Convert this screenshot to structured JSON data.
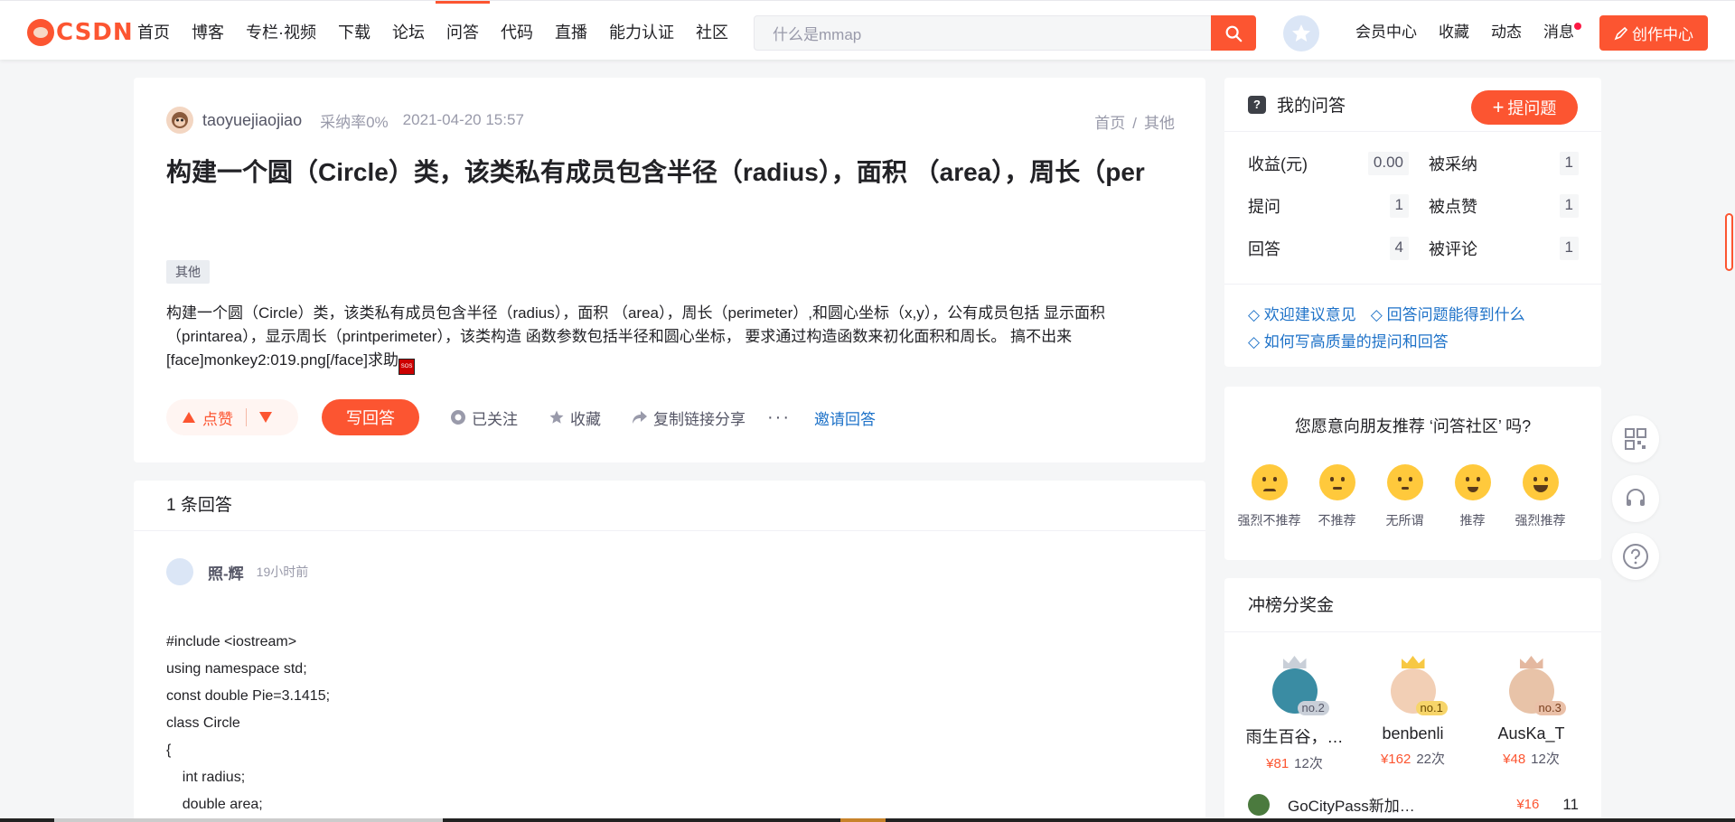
{
  "nav": {
    "logo": "CSDN",
    "items": [
      "首页",
      "博客",
      "专栏·视频",
      "下载",
      "论坛",
      "问答",
      "代码",
      "直播",
      "能力认证",
      "社区"
    ],
    "active_index": 5,
    "search_placeholder": "什么是mmap",
    "right_items": [
      "会员中心",
      "收藏",
      "动态",
      "消息"
    ],
    "create_label": "创作中心",
    "accent": "#fc5531"
  },
  "question": {
    "author": "taoyuejiaojiao",
    "accept_rate": "采纳率0%",
    "time": "2021-04-20 15:57",
    "breadcrumb": [
      "首页",
      "其他"
    ],
    "title": "构建一个圆（Circle）类，该类私有成员包含半径（radius），面积 （area），周长（per",
    "tag": "其他",
    "body": "构建一个圆（Circle）类，该类私有成员包含半径（radius），面积 （area），周长（perimeter）,和圆心坐标（x,y），公有成员包括 显示面积（printarea），显示周长（printperimeter），该类构造 函数参数包括半径和圆心坐标， 要求通过构造函数来初化面积和周长。 搞不出来[face]monkey2:019.png[/face]求助",
    "actions": {
      "like": "点赞",
      "write": "写回答",
      "follow": "已关注",
      "favorite": "收藏",
      "share": "复制链接分享",
      "more": "···",
      "invite": "邀请回答"
    }
  },
  "answers": {
    "count_label": "1 条回答",
    "items": [
      {
        "user": "照-辉",
        "time": "19小时前",
        "code": [
          "#include <iostream>",
          "using namespace std;",
          "const double Pie=3.1415;",
          "class Circle",
          "{",
          "    int radius;",
          "    double area;"
        ]
      }
    ]
  },
  "my_questions": {
    "title": "我的问答",
    "ask_label": "提问题",
    "stats": [
      [
        {
          "label": "收益(元)",
          "value": "0.00"
        },
        {
          "label": "被采纳",
          "value": "1"
        }
      ],
      [
        {
          "label": "提问",
          "value": "1"
        },
        {
          "label": "被点赞",
          "value": "1"
        }
      ],
      [
        {
          "label": "回答",
          "value": "4"
        },
        {
          "label": "被评论",
          "value": "1"
        }
      ]
    ],
    "links": [
      "◇ 欢迎建议意见",
      "◇ 回答问题能得到什么",
      "◇ 如何写高质量的提问和回答"
    ]
  },
  "recommend": {
    "title": "您愿意向朋友推荐 ‘问答社区’ 吗?",
    "options": [
      "强烈不推荐",
      "不推荐",
      "无所谓",
      "推荐",
      "强烈推荐"
    ]
  },
  "ranking": {
    "title": "冲榜分奖金",
    "podium": [
      {
        "rank": "no.2",
        "name": "雨生百谷，…",
        "money": "¥81",
        "times": "12次"
      },
      {
        "rank": "no.1",
        "name": "benbenli",
        "money": "¥162",
        "times": "22次"
      },
      {
        "rank": "no.3",
        "name": "AusKa_T",
        "money": "¥48",
        "times": "12次"
      }
    ],
    "next": {
      "name": "GoCityPass新加…",
      "money": "¥16",
      "times": "11"
    }
  }
}
